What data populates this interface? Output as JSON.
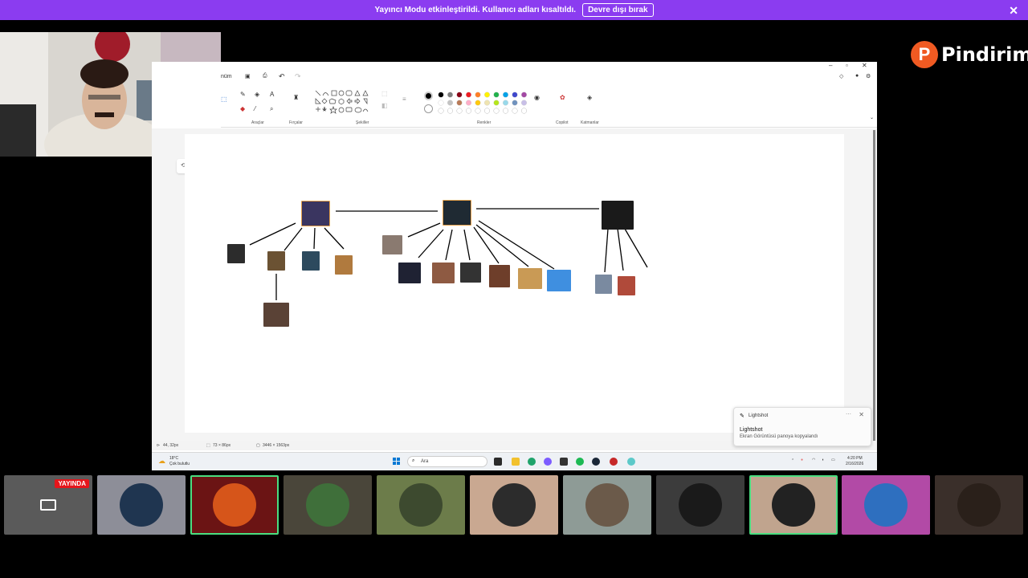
{
  "banner": {
    "message": "Yayıncı Modu etkinleştirildi. Kullanıcı adları kısaltıldı.",
    "button": "Devre dışı bırak",
    "close": "✕"
  },
  "logo": {
    "mark": "P",
    "text": "Pindirim"
  },
  "paint": {
    "menu_tab": "nüm",
    "groups": {
      "tools": "Araçlar",
      "brushes": "Fırçalar",
      "shapes": "Şekiller",
      "colors": "Renkler",
      "copilot": "Copilot",
      "layers": "Katmanlar"
    },
    "palette": [
      "#000000",
      "#7f7f7f",
      "#880015",
      "#ed1c24",
      "#ff7f27",
      "#fff200",
      "#22b14c",
      "#00a2e8",
      "#3f48cc",
      "#a349a4",
      "#ffffff",
      "#c3c3c3",
      "#b97a57",
      "#ffaec9",
      "#ffc90e",
      "#efe4b0",
      "#b5e61d",
      "#99d9ea",
      "#7092be",
      "#c8bfe7"
    ],
    "status": {
      "cursor": "44, 32px",
      "selection": "73 × 86px",
      "canvas_size": "3446 × 1563px"
    }
  },
  "taskbar": {
    "weather_temp": "18°C",
    "weather_desc": "Çok bulutlu",
    "search": "Ara",
    "time": "4:20 PM",
    "date": "2/16/2026"
  },
  "toast": {
    "app": "Lightshot",
    "title": "Lightshot",
    "body": "Ekran Görüntüsü panoya kopyalandı",
    "close": "✕"
  },
  "strip": {
    "live_label": "YAYINDA",
    "tiles": [
      {
        "bg": "#5a5a5a",
        "avatar": "#3a3a3a"
      },
      {
        "bg": "#8d8e98",
        "avatar": "#1f3550"
      },
      {
        "bg": "#6b1414",
        "avatar": "#d6551a"
      },
      {
        "bg": "#4a463a",
        "avatar": "#3f6f3a"
      },
      {
        "bg": "#6c7c4a",
        "avatar": "#3d4a2f"
      },
      {
        "bg": "#c9a891",
        "avatar": "#2c2c2c"
      },
      {
        "bg": "#8e9b96",
        "avatar": "#6b5a4a"
      },
      {
        "bg": "#3c3c3c",
        "avatar": "#1a1a1a"
      },
      {
        "bg": "#c0a48e",
        "avatar": "#222222"
      },
      {
        "bg": "#b24aa6",
        "avatar": "#2e6fbf"
      },
      {
        "bg": "#3a2f2a",
        "avatar": "#2a201a"
      }
    ]
  }
}
